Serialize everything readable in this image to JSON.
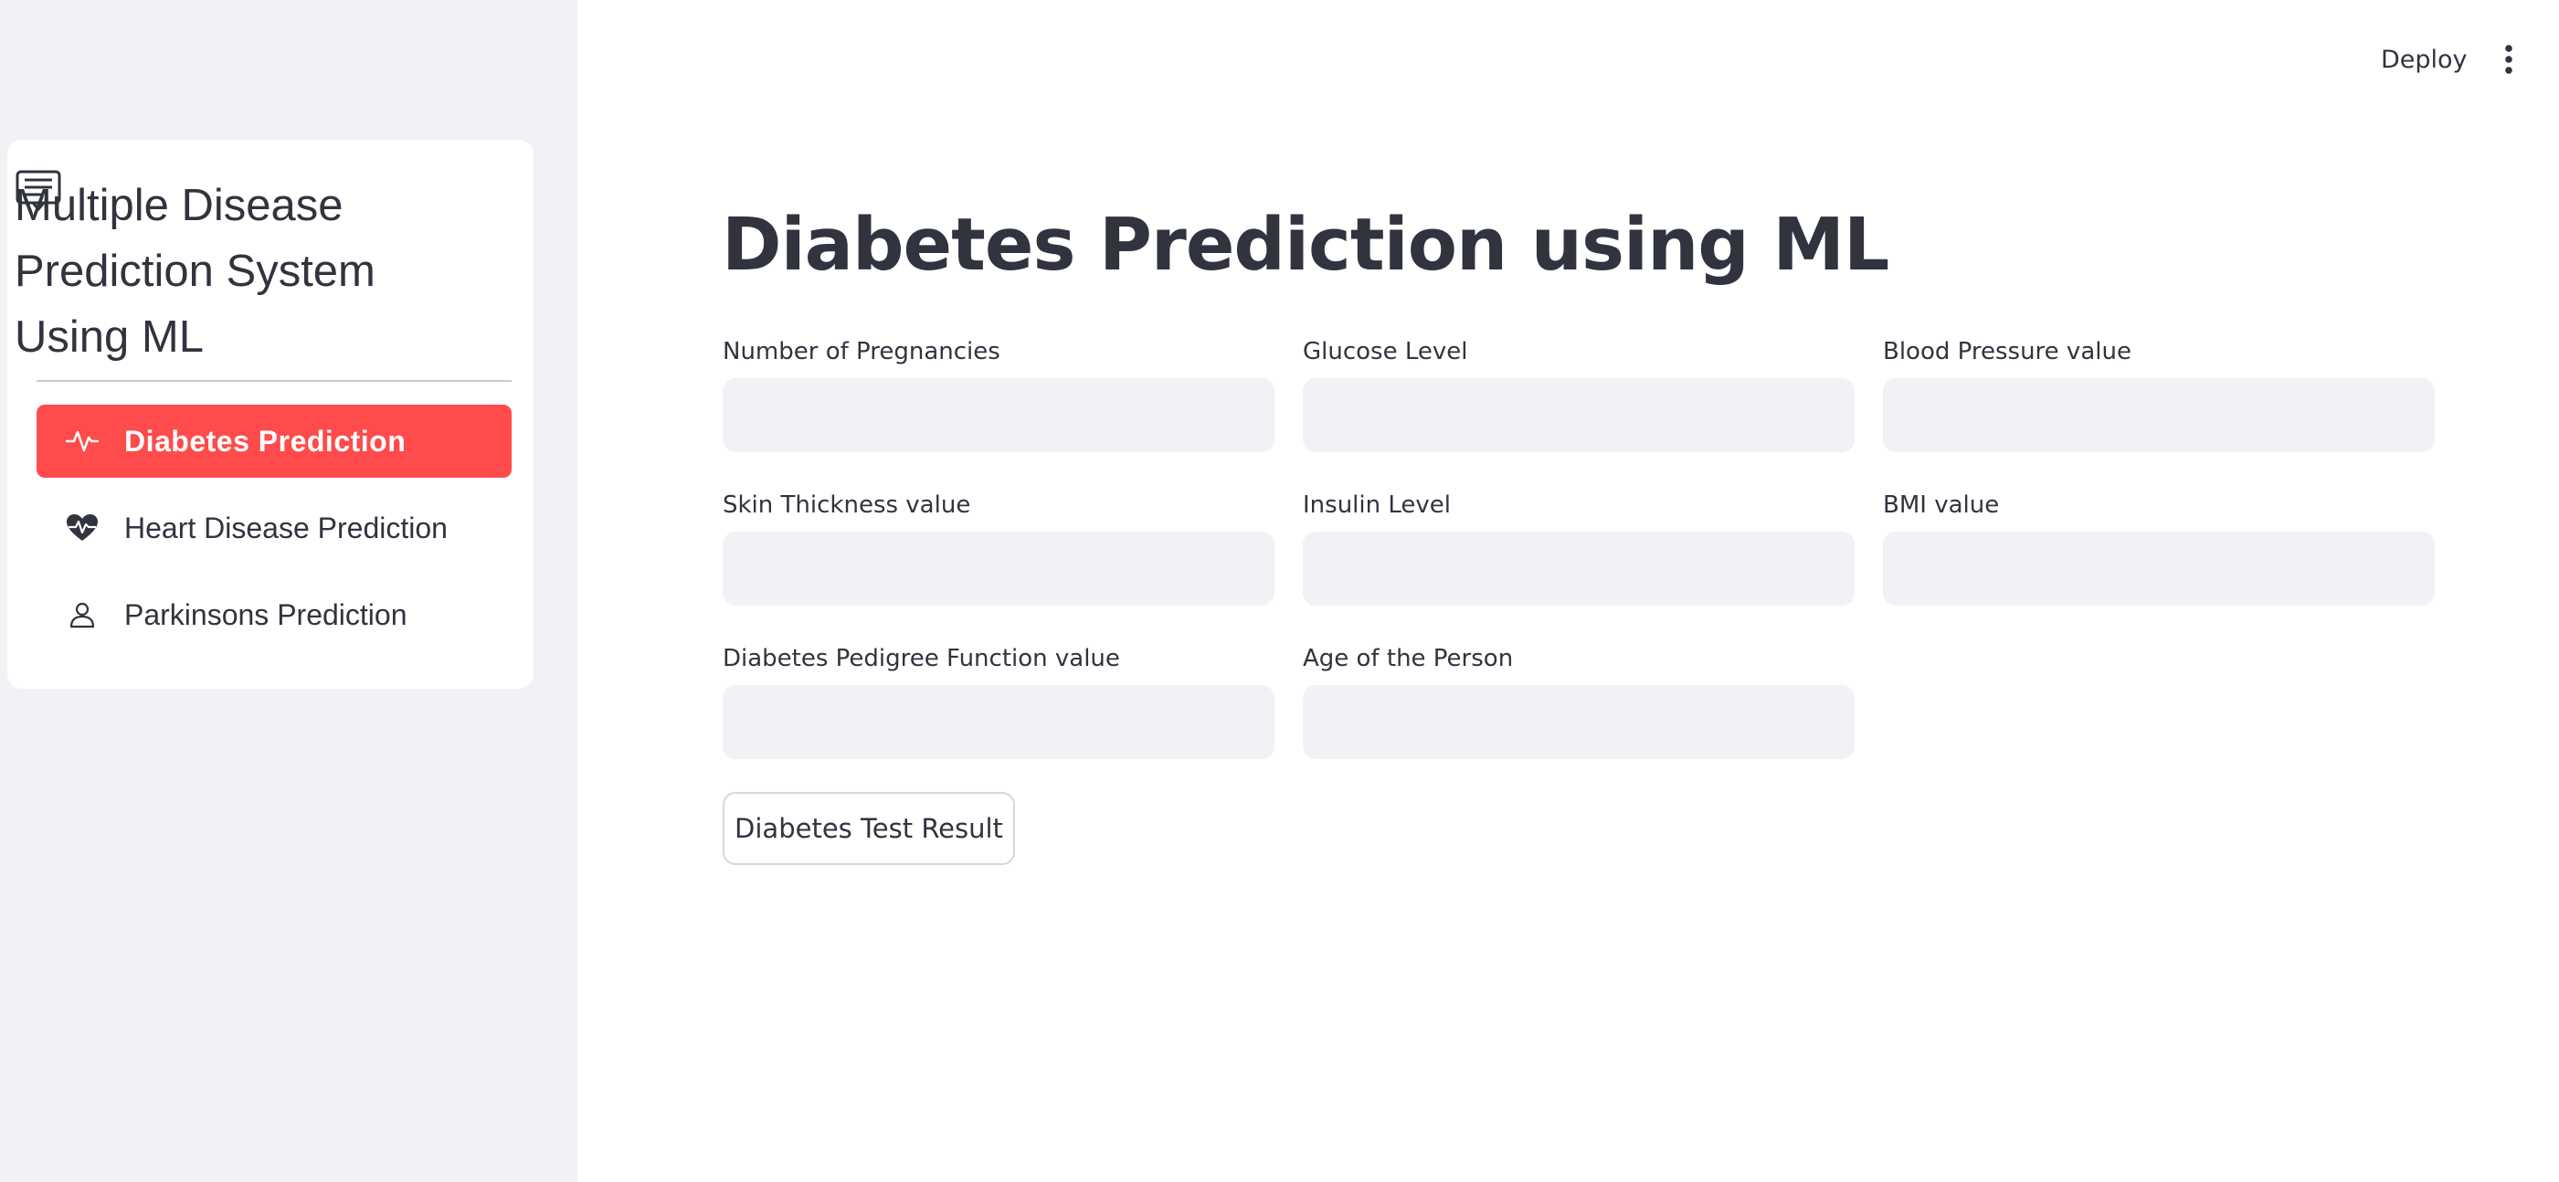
{
  "sidebar": {
    "menu_icon": "newspaper-icon",
    "menu_title": "Multiple Disease Prediction System Using ML",
    "items": [
      {
        "label": "Diabetes Prediction",
        "icon": "activity-icon",
        "active": true
      },
      {
        "label": "Heart Disease Prediction",
        "icon": "heart-pulse-icon",
        "active": false
      },
      {
        "label": "Parkinsons Prediction",
        "icon": "person-icon",
        "active": false
      }
    ],
    "active_color": "#ff4b4b"
  },
  "header": {
    "deploy_label": "Deploy",
    "menu_icon": "kebab-menu-icon"
  },
  "main": {
    "title": "Diabetes Prediction using ML",
    "fields": [
      {
        "label": "Number of Pregnancies",
        "value": ""
      },
      {
        "label": "Glucose Level",
        "value": ""
      },
      {
        "label": "Blood Pressure value",
        "value": ""
      },
      {
        "label": "Skin Thickness value",
        "value": ""
      },
      {
        "label": "Insulin Level",
        "value": ""
      },
      {
        "label": "BMI value",
        "value": ""
      },
      {
        "label": "Diabetes Pedigree Function value",
        "value": ""
      },
      {
        "label": "Age of the Person",
        "value": ""
      }
    ],
    "submit_label": "Diabetes Test Result"
  }
}
